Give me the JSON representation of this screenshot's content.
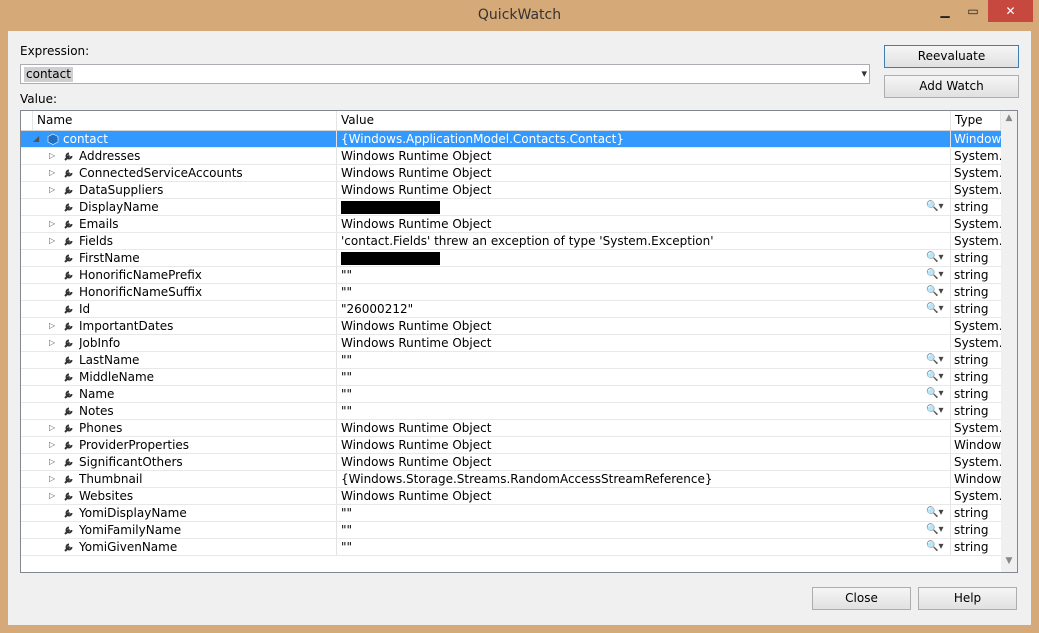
{
  "window": {
    "title": "QuickWatch",
    "close_glyph": "✕",
    "min_glyph": "▁",
    "max_glyph": "▭"
  },
  "expression": {
    "label": "Expression:",
    "value": "contact"
  },
  "value_label": "Value:",
  "buttons": {
    "reevaluate": "Reevaluate",
    "add_watch": "Add Watch",
    "close": "Close",
    "help": "Help"
  },
  "columns": {
    "name": "Name",
    "value": "Value",
    "type": "Type"
  },
  "rows": [
    {
      "name": "contact",
      "value": "{Windows.ApplicationModel.Contacts.Contact}",
      "type": "Window",
      "expand": "open",
      "icon": "object-icon",
      "selected": true,
      "level": 0
    },
    {
      "name": "Addresses",
      "value": "Windows Runtime Object",
      "type": "System.C",
      "expand": "closed",
      "icon": "property-icon",
      "level": 1
    },
    {
      "name": "ConnectedServiceAccounts",
      "value": "Windows Runtime Object",
      "type": "System.C",
      "expand": "closed",
      "icon": "property-icon",
      "level": 1
    },
    {
      "name": "DataSuppliers",
      "value": "Windows Runtime Object",
      "type": "System.C",
      "expand": "closed",
      "icon": "property-icon",
      "level": 1
    },
    {
      "name": "DisplayName",
      "value": "",
      "type": "string",
      "expand": "none",
      "icon": "property-icon",
      "redacted": true,
      "magnifier": true,
      "level": 1
    },
    {
      "name": "Emails",
      "value": "Windows Runtime Object",
      "type": "System.C",
      "expand": "closed",
      "icon": "property-icon",
      "level": 1
    },
    {
      "name": "Fields",
      "value": "'contact.Fields' threw an exception of type 'System.Exception'",
      "type": "System.C",
      "expand": "closed",
      "icon": "property-icon",
      "level": 1
    },
    {
      "name": "FirstName",
      "value": "",
      "type": "string",
      "expand": "none",
      "icon": "property-icon",
      "redacted": true,
      "magnifier": true,
      "level": 1
    },
    {
      "name": "HonorificNamePrefix",
      "value": "\"\"",
      "type": "string",
      "expand": "none",
      "icon": "property-icon",
      "magnifier": true,
      "level": 1
    },
    {
      "name": "HonorificNameSuffix",
      "value": "\"\"",
      "type": "string",
      "expand": "none",
      "icon": "property-icon",
      "magnifier": true,
      "level": 1
    },
    {
      "name": "Id",
      "value": "\"26000212\"",
      "type": "string",
      "expand": "none",
      "icon": "property-icon",
      "magnifier": true,
      "level": 1
    },
    {
      "name": "ImportantDates",
      "value": "Windows Runtime Object",
      "type": "System.C",
      "expand": "closed",
      "icon": "property-icon",
      "level": 1
    },
    {
      "name": "JobInfo",
      "value": "Windows Runtime Object",
      "type": "System.C",
      "expand": "closed",
      "icon": "property-icon",
      "level": 1
    },
    {
      "name": "LastName",
      "value": "\"\"",
      "type": "string",
      "expand": "none",
      "icon": "property-icon",
      "magnifier": true,
      "level": 1
    },
    {
      "name": "MiddleName",
      "value": "\"\"",
      "type": "string",
      "expand": "none",
      "icon": "property-icon",
      "magnifier": true,
      "level": 1
    },
    {
      "name": "Name",
      "value": "\"\"",
      "type": "string",
      "expand": "none",
      "icon": "property-icon",
      "magnifier": true,
      "level": 1
    },
    {
      "name": "Notes",
      "value": "\"\"",
      "type": "string",
      "expand": "none",
      "icon": "property-icon",
      "magnifier": true,
      "level": 1
    },
    {
      "name": "Phones",
      "value": "Windows Runtime Object",
      "type": "System.C",
      "expand": "closed",
      "icon": "property-icon",
      "level": 1
    },
    {
      "name": "ProviderProperties",
      "value": "Windows Runtime Object",
      "type": "Window",
      "expand": "closed",
      "icon": "property-icon",
      "level": 1
    },
    {
      "name": "SignificantOthers",
      "value": "Windows Runtime Object",
      "type": "System.C",
      "expand": "closed",
      "icon": "property-icon",
      "level": 1
    },
    {
      "name": "Thumbnail",
      "value": "{Windows.Storage.Streams.RandomAccessStreamReference}",
      "type": "Window",
      "expand": "closed",
      "icon": "property-icon",
      "level": 1
    },
    {
      "name": "Websites",
      "value": "Windows Runtime Object",
      "type": "System.C",
      "expand": "closed",
      "icon": "property-icon",
      "level": 1
    },
    {
      "name": "YomiDisplayName",
      "value": "\"\"",
      "type": "string",
      "expand": "none",
      "icon": "property-icon",
      "magnifier": true,
      "level": 1
    },
    {
      "name": "YomiFamilyName",
      "value": "\"\"",
      "type": "string",
      "expand": "none",
      "icon": "property-icon",
      "magnifier": true,
      "level": 1
    },
    {
      "name": "YomiGivenName",
      "value": "\"\"",
      "type": "string",
      "expand": "none",
      "icon": "property-icon",
      "magnifier": true,
      "level": 1
    }
  ],
  "magnifier_glyph": "🔍▾"
}
